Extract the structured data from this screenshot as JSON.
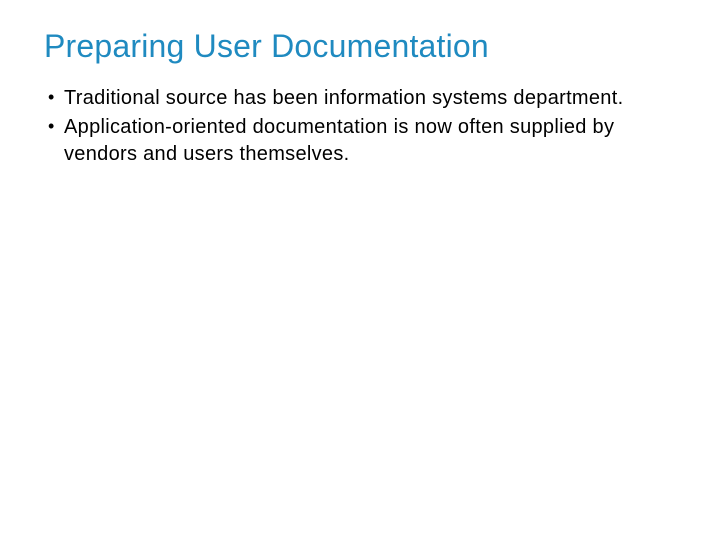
{
  "slide": {
    "title": "Preparing User Documentation",
    "bullets": [
      "Traditional source has been information systems department.",
      "Application-oriented documentation is now often supplied by vendors and users themselves."
    ]
  }
}
